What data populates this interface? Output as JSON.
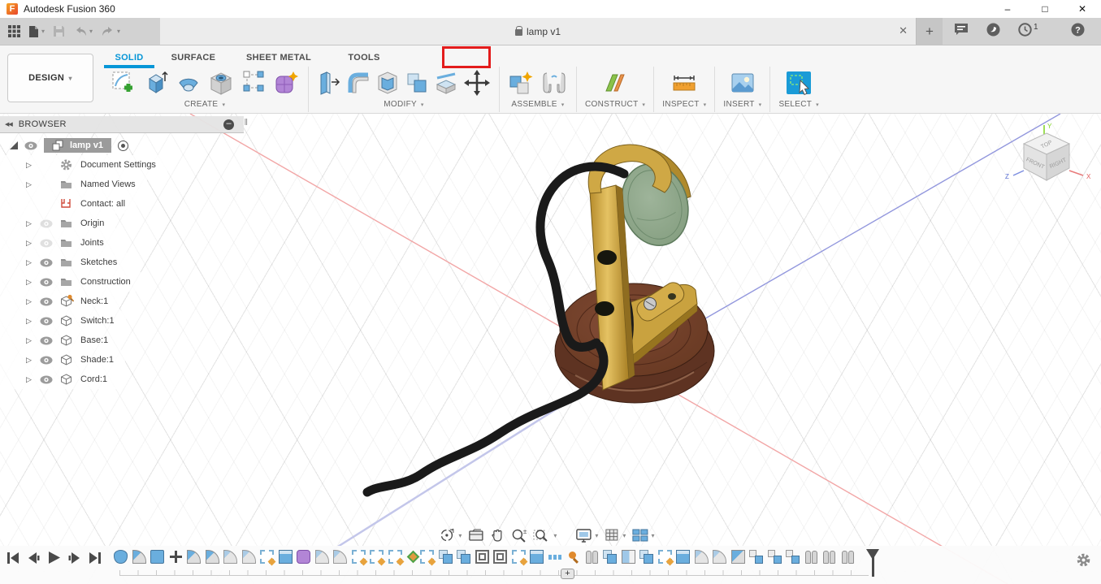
{
  "window": {
    "title": "Autodesk Fusion 360",
    "min": "–",
    "max": "□",
    "close": "✕"
  },
  "tabstrip": {
    "document": "lamp v1",
    "close": "✕",
    "new_tab": "+",
    "badge": "1",
    "help": "?"
  },
  "ribbon": {
    "workspace": "DESIGN",
    "caret": "▾",
    "tabs": [
      {
        "label": "SOLID",
        "active": true
      },
      {
        "label": "SURFACE",
        "active": false
      },
      {
        "label": "SHEET METAL",
        "active": false
      },
      {
        "label": "TOOLS",
        "active": false,
        "annotated": true
      }
    ],
    "groups": [
      {
        "label": "CREATE"
      },
      {
        "label": "MODIFY"
      },
      {
        "label": "ASSEMBLE"
      },
      {
        "label": "CONSTRUCT"
      },
      {
        "label": "INSPECT"
      },
      {
        "label": "INSERT"
      },
      {
        "label": "SELECT"
      }
    ],
    "tools": {
      "create": [
        "create-sketch",
        "extrude",
        "revolve",
        "hole",
        "rectangular-pattern",
        "create-form"
      ],
      "modify": [
        "press-pull",
        "fillet",
        "shell",
        "combine",
        "split-body",
        "move"
      ],
      "assemble": [
        "new-component",
        "joint"
      ],
      "construct": [
        "construct-plane"
      ],
      "inspect": [
        "measure"
      ],
      "insert": [
        "insert-image"
      ],
      "select": [
        "select"
      ]
    }
  },
  "browser": {
    "collapse": "◀◀",
    "header": "BROWSER",
    "minus": "–",
    "grip": "| |",
    "root": "lamp v1",
    "items": [
      {
        "label": "Document Settings",
        "icon": "gear",
        "eye": "none",
        "arrow": true
      },
      {
        "label": "Named Views",
        "icon": "folder",
        "eye": "none",
        "arrow": true
      },
      {
        "label": "Contact: all",
        "icon": "contact",
        "eye": "none",
        "arrow": false
      },
      {
        "label": "Origin",
        "icon": "folder",
        "eye": "hidden",
        "arrow": true
      },
      {
        "label": "Joints",
        "icon": "folder",
        "eye": "hidden",
        "arrow": true
      },
      {
        "label": "Sketches",
        "icon": "folder",
        "eye": "visible",
        "arrow": true
      },
      {
        "label": "Construction",
        "icon": "folder",
        "eye": "visible",
        "arrow": true
      },
      {
        "label": "Neck:1",
        "icon": "component-pinned",
        "eye": "visible",
        "arrow": true
      },
      {
        "label": "Switch:1",
        "icon": "component",
        "eye": "visible",
        "arrow": true
      },
      {
        "label": "Base:1",
        "icon": "component",
        "eye": "visible",
        "arrow": true
      },
      {
        "label": "Shade:1",
        "icon": "component",
        "eye": "visible",
        "arrow": true
      },
      {
        "label": "Cord:1",
        "icon": "component",
        "eye": "visible",
        "arrow": true
      }
    ],
    "tree_arrow": "▷"
  },
  "viewport": {
    "viewcube": {
      "top": "TOP",
      "front": "FRONT",
      "right": "RIGHT",
      "axis_x": "X",
      "axis_y": "Y",
      "axis_z": "Z"
    },
    "colors": {
      "accent": "#0696d7",
      "annotation_red": "#e31c1c",
      "axis_x": "#f2a6a6",
      "axis_z": "#9297dd",
      "axis_z_far": "#c3c6ea",
      "brass": "#c9a23f",
      "brass_light": "#cfa845",
      "wood": "#6b3a27",
      "shade_green": "#8da689",
      "cord": "#1a1a1a"
    }
  },
  "navbar": {
    "items": [
      "orbit",
      "look-at",
      "pan",
      "zoom",
      "fit",
      "display-settings",
      "grid-display",
      "viewports"
    ]
  },
  "timeline": {
    "plus": "+",
    "features": [
      {
        "t": "t-revolve"
      },
      {
        "t": "t-fillet"
      },
      {
        "t": "t-box"
      },
      {
        "t": "t-move"
      },
      {
        "t": "t-fillet"
      },
      {
        "t": "t-fillet"
      },
      {
        "t": "t-fillet2"
      },
      {
        "t": "t-fillet2"
      },
      {
        "t": "t-sketch"
      },
      {
        "t": "t-extrude"
      },
      {
        "t": "t-form"
      },
      {
        "t": "t-fillet2"
      },
      {
        "t": "t-fillet2"
      },
      {
        "t": "t-sketch"
      },
      {
        "t": "t-sketch"
      },
      {
        "t": "t-sketch"
      },
      {
        "t": "t-project"
      },
      {
        "t": "t-sketch"
      },
      {
        "t": "t-combine"
      },
      {
        "t": "t-combine"
      },
      {
        "t": "t-offset"
      },
      {
        "t": "t-offset"
      },
      {
        "t": "t-sketch"
      },
      {
        "t": "t-extrude"
      },
      {
        "t": "t-pattern"
      },
      {
        "t": "t-pin"
      },
      {
        "t": "t-joint"
      },
      {
        "t": "t-combine"
      },
      {
        "t": "t-plane"
      },
      {
        "t": "t-combine"
      },
      {
        "t": "t-sketch"
      },
      {
        "t": "t-extrude"
      },
      {
        "t": "t-fillet2"
      },
      {
        "t": "t-fillet2"
      },
      {
        "t": "t-chamfer"
      },
      {
        "t": "t-derive"
      },
      {
        "t": "t-derive"
      },
      {
        "t": "t-derive"
      },
      {
        "t": "t-joint"
      },
      {
        "t": "t-joint"
      },
      {
        "t": "t-joint"
      }
    ]
  }
}
